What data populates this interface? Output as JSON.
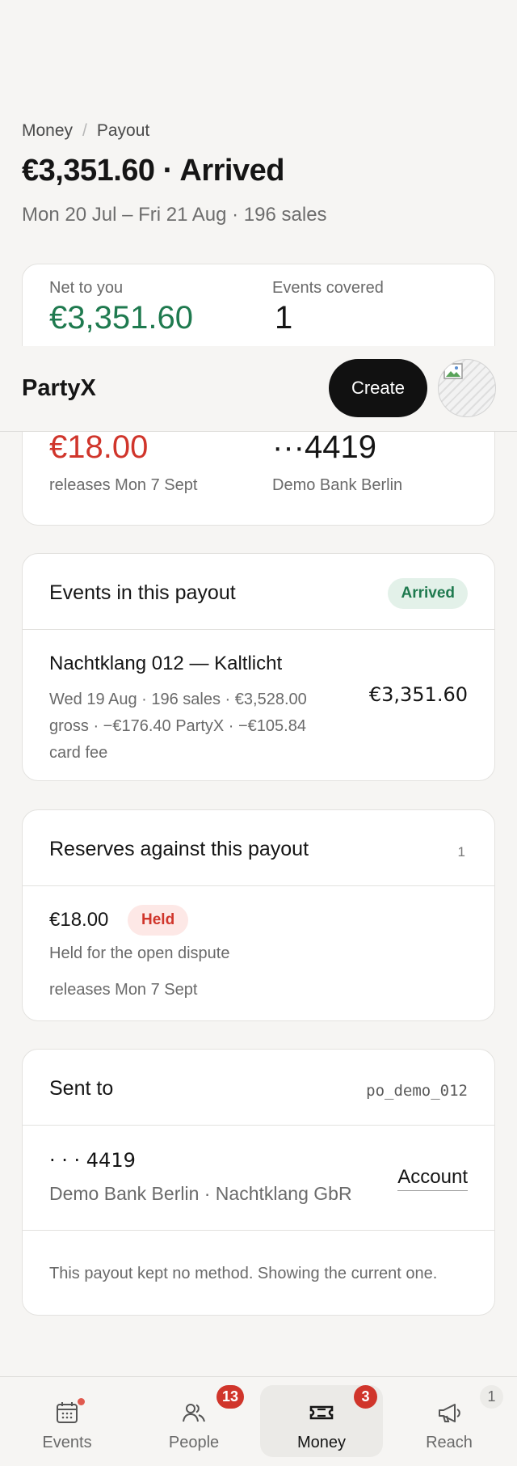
{
  "breadcrumb": {
    "root": "Money",
    "separator": "/",
    "current": "Payout"
  },
  "title": "€3,351.60 · Arrived",
  "subtitle": "Mon 20 Jul – Fri 21 Aug · 196 sales",
  "stats": {
    "net_label": "Net to you",
    "net_value": "€3,351.60",
    "events_label": "Events covered",
    "events_value": "1",
    "reserve_value": "€18.00",
    "reserve_caption": "releases Mon 7 Sept",
    "account_value": "···4419",
    "account_caption": "Demo Bank Berlin"
  },
  "topbar": {
    "brand": "PartyX",
    "create_label": "Create"
  },
  "events_section": {
    "title": "Events in this payout",
    "status": "Arrived",
    "event": {
      "name": "Nachtklang 012 — Kaltlicht",
      "meta": "Wed 19 Aug · 196 sales · €3,528.00 gross · −€176.40 PartyX · −€105.84 card fee",
      "amount": "€3,351.60"
    }
  },
  "reserves_section": {
    "title": "Reserves against this payout",
    "count": "1",
    "reserve": {
      "amount": "€18.00",
      "status": "Held",
      "reason": "Held for the open dispute",
      "release": "releases Mon 7 Sept"
    }
  },
  "sent_section": {
    "title": "Sent to",
    "payout_id": "po_demo_012",
    "account_mask": "· · · 4419",
    "bank_line": "Demo Bank Berlin · Nachtklang GbR",
    "account_link": "Account",
    "note": "This payout kept no method. Showing the current one."
  },
  "nav": {
    "items": [
      {
        "label": "Events",
        "icon": "calendar-icon"
      },
      {
        "label": "People",
        "icon": "people-icon",
        "badge": "13"
      },
      {
        "label": "Money",
        "icon": "ticket-icon",
        "badge": "3",
        "active": true
      },
      {
        "label": "Reach",
        "icon": "megaphone-icon",
        "badge": "1"
      }
    ]
  },
  "colors": {
    "positive": "#1f7a4f",
    "negative": "#d0352b",
    "accent_dark": "#111111"
  }
}
